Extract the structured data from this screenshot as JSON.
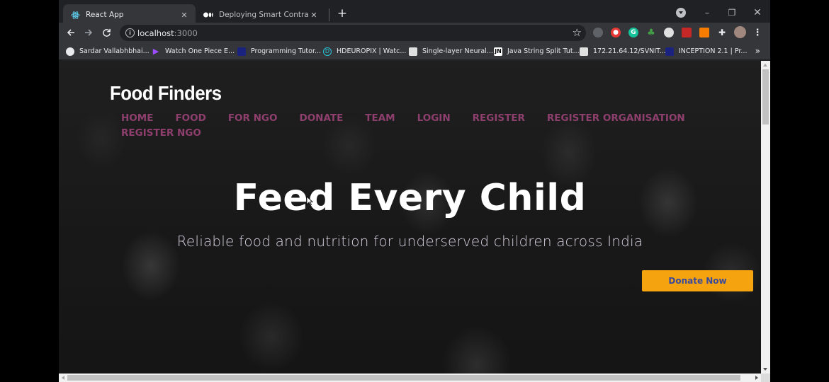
{
  "browser": {
    "tabs": [
      {
        "title": "React App",
        "favicon": "react-icon",
        "active": true
      },
      {
        "title": "Deploying Smart Contracts with",
        "favicon": "medium-icon",
        "active": false
      }
    ],
    "new_tab_label": "+",
    "window_controls": {
      "minimize": "–",
      "restore": "❐",
      "close": "✕"
    },
    "address": {
      "host": "localhost",
      "port": ":3000"
    },
    "bookmarks": [
      {
        "label": "Sardar Vallabhbhai...",
        "icon": "globe-icon",
        "color": "#e8eaed"
      },
      {
        "label": "Watch One Piece E...",
        "icon": "play-icon",
        "color": "#9c4dff"
      },
      {
        "label": "Programming Tutor...",
        "icon": "site-icon",
        "color": "#1a237e"
      },
      {
        "label": "HDEUROPIX | Watc...",
        "icon": "hd-icon",
        "color": "#26c6da"
      },
      {
        "label": "Single-layer Neural...",
        "icon": "page-icon",
        "color": "#e0e0e0"
      },
      {
        "label": "Java String Split Tut...",
        "icon": "jn-icon",
        "color": "#ffffff"
      },
      {
        "label": "172.21.64.12/SVNIT...",
        "icon": "doc-icon",
        "color": "#e0e0e0"
      },
      {
        "label": "INCEPTION 2.1 | Pr...",
        "icon": "site-icon",
        "color": "#1a237e"
      }
    ],
    "bookmarks_more": "»"
  },
  "site": {
    "brand": "Food Finders",
    "nav": [
      "HOME",
      "FOOD",
      "FOR NGO",
      "DONATE",
      "TEAM",
      "LOGIN",
      "REGISTER",
      "REGISTER ORGANISATION",
      "REGISTER NGO"
    ],
    "hero_title": "Feed Every Child",
    "hero_subtitle": "Reliable food and nutrition for underserved children across India",
    "cta": "Donate Now",
    "colors": {
      "nav": "#8e3f6d",
      "cta_bg": "#f5a30f",
      "cta_text": "#3a4a9a"
    }
  }
}
